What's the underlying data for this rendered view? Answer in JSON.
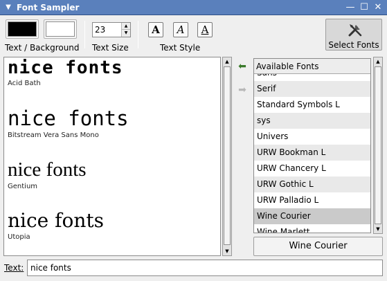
{
  "window": {
    "title": "Font Sampler",
    "menu_glyph": "▼",
    "minimize_glyph": "—",
    "maximize_glyph": "☐",
    "close_glyph": "✕"
  },
  "toolbar": {
    "foreground_color": "#000000",
    "background_color": "#ffffff",
    "colors_label": "Text / Background",
    "size_value": "23",
    "size_label": "Text Size",
    "style_bold_glyph": "A",
    "style_italic_glyph": "A",
    "style_underline_glyph": "A",
    "style_label": "Text Style",
    "select_fonts_label": "Select Fonts"
  },
  "preview": {
    "items": [
      {
        "sample": "nice fonts",
        "font_name": "Acid Bath"
      },
      {
        "sample": "nice fonts",
        "font_name": "Bitstream Vera Sans Mono"
      },
      {
        "sample": "nice fonts",
        "font_name": "Gentium"
      },
      {
        "sample": "nice fonts",
        "font_name": "Utopia"
      }
    ]
  },
  "arrows": {
    "add_glyph": "⬅",
    "remove_glyph": "➡"
  },
  "font_list": {
    "header": "Available Fonts",
    "items": [
      "Sans",
      "Serif",
      "Standard Symbols L",
      "sys",
      "Univers",
      "URW Bookman L",
      "URW Chancery L",
      "URW Gothic L",
      "URW Palladio L",
      "Wine Courier",
      "Wine Marlett"
    ],
    "selected": "Wine Courier"
  },
  "selected_font_button": "Wine Courier",
  "text_field": {
    "label": "Text:",
    "value": "nice fonts"
  },
  "scroll_arrows": {
    "up": "▲",
    "down": "▼"
  },
  "colors": {
    "titlebar": "#5a80bc",
    "selection": "#cacaca",
    "row_alt": "#e9e9e9"
  }
}
